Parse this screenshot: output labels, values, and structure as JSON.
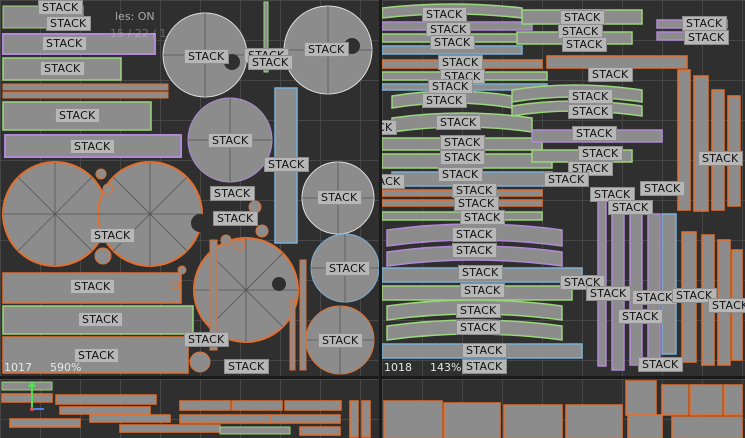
{
  "viewport": {
    "stack_label": "STACK",
    "overlay_top_line1": "les: ON",
    "overlay_top_line2": "15 / 22 / 1",
    "tiles": [
      {
        "id": "1017",
        "zoom": "590%"
      },
      {
        "id": "1018",
        "zoom": "143%"
      }
    ]
  },
  "colors": {
    "background": "#2f2f2f",
    "grid": "#474747",
    "uv_fill": "#8c8c8c",
    "edge_orange": "#e07030",
    "edge_green": "#9ad67a",
    "edge_purple": "#b08ad6",
    "edge_blue": "#7ab0d6",
    "label_bg": "#b7b7b7"
  },
  "gizmo": {
    "x_axis_color": "#e05050",
    "y_axis_color": "#50e050",
    "z_axis_color": "#5080f0"
  }
}
